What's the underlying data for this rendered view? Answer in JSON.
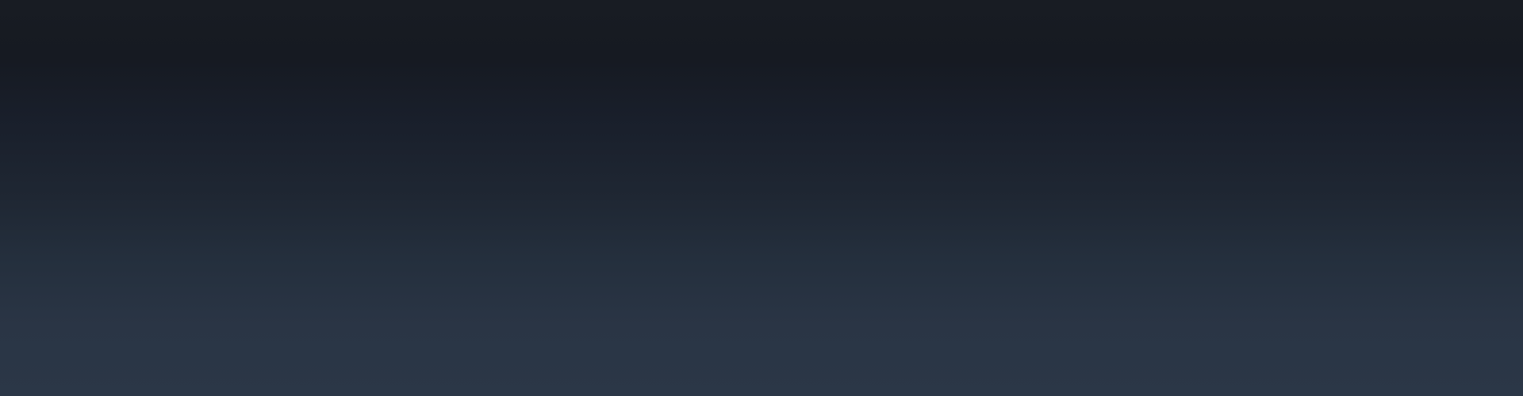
{
  "background": {
    "gradient_top_color": "#161a22",
    "gradient_bottom_color": "#2b3747"
  }
}
